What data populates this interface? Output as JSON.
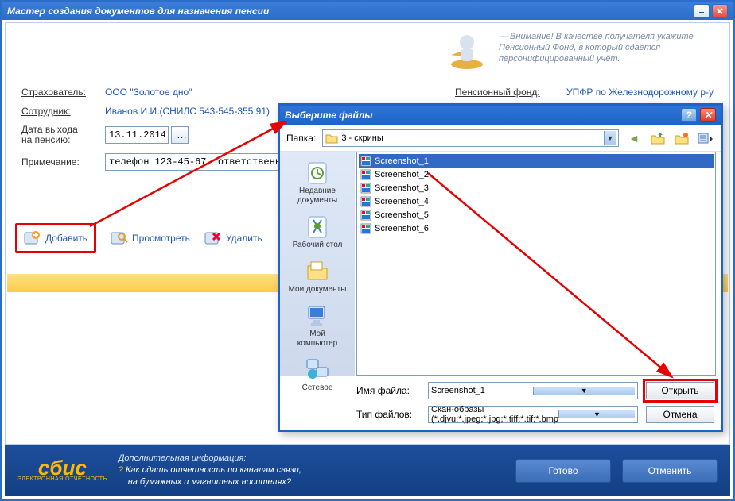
{
  "window": {
    "title": "Мастер создания документов для назначения пенсии"
  },
  "hint": "— Внимание! В качестве получателя укажите Пенсионный Фонд, в который сдается персонифицированный учёт.",
  "form": {
    "insurer_label": "Страхователь:",
    "insurer_value": "ООО \"Золотое дно\"",
    "pf_label": "Пенсионный фонд:",
    "pf_value": "УПФР по Железнодорожному р-у",
    "employee_label": "Сотрудник:",
    "employee_value": "Иванов И.И.(СНИЛС 543-545-355 91)",
    "retire_label": "Дата выхода\nна пенсию:",
    "retire_date": "13.11.2014",
    "note_label": "Примечание:",
    "note_value": "телефон 123-45-67, ответственны"
  },
  "actions": {
    "add": "Добавить",
    "view": "Просмотреть",
    "delete": "Удалить"
  },
  "file_picker": {
    "title": "Выберите файлы",
    "folder_label": "Папка:",
    "folder_value": "3 - скрины",
    "sidebar": {
      "recent": "Недавние\nдокументы",
      "desktop": "Рабочий стол",
      "mydocs": "Мои документы",
      "mycomp": "Мой\nкомпьютер",
      "network": "Сетевое"
    },
    "files": [
      "Screenshot_1",
      "Screenshot_2",
      "Screenshot_3",
      "Screenshot_4",
      "Screenshot_5",
      "Screenshot_6"
    ],
    "filename_label": "Имя файла:",
    "filename_value": "Screenshot_1",
    "filetype_label": "Тип файлов:",
    "filetype_value": "Скан-образы (*.djvu;*.jpeg;*.jpg;*.tiff;*.tif;*.bmp",
    "open": "Открыть",
    "cancel": "Отмена"
  },
  "footer": {
    "logo": "сбис",
    "logo_sub": "ЭЛЕКТРОННАЯ ОТЧЕТНОСТЬ",
    "head": "Дополнительная информация:",
    "line1": "Как сдать отчетность по каналам связи,",
    "line2": "на бумажных и магнитных носителях?",
    "done": "Готово",
    "cancel": "Отменить"
  }
}
